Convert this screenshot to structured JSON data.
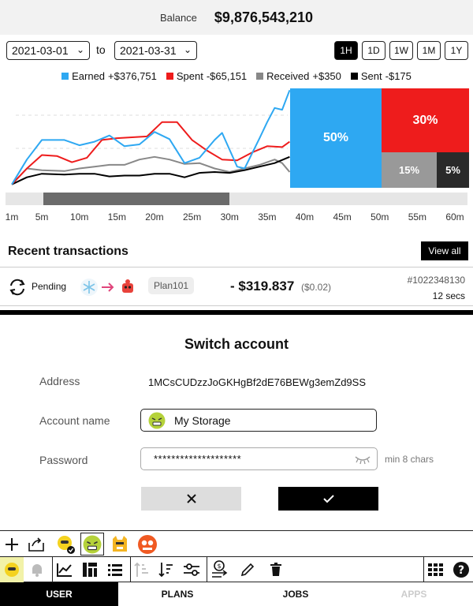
{
  "balance": {
    "label": "Balance",
    "value": "$9,876,543,210"
  },
  "date_range": {
    "from": "2021-03-01",
    "to_label": "to",
    "to": "2021-03-31"
  },
  "range_buttons": [
    {
      "label": "1H",
      "active": true
    },
    {
      "label": "1D",
      "active": false
    },
    {
      "label": "1W",
      "active": false
    },
    {
      "label": "1M",
      "active": false
    },
    {
      "label": "1Y",
      "active": false
    }
  ],
  "legend": [
    {
      "name": "Earned",
      "value": "+$376,751",
      "color": "#2ea8f2"
    },
    {
      "name": "Spent",
      "value": "-$65,151",
      "color": "#ee1c1c"
    },
    {
      "name": "Received",
      "value": "+$350",
      "color": "#888888"
    },
    {
      "name": "Sent",
      "value": "-$175",
      "color": "#000000"
    }
  ],
  "chart_data": {
    "type": "line",
    "x_ticks": [
      "1m",
      "5m",
      "10m",
      "15m",
      "20m",
      "25m",
      "30m",
      "35m",
      "40m",
      "45m",
      "50m",
      "55m",
      "60m"
    ],
    "series": [
      {
        "name": "Earned",
        "color": "#2ea8f2",
        "points": [
          [
            1,
            2
          ],
          [
            3,
            30
          ],
          [
            5,
            52
          ],
          [
            8,
            52
          ],
          [
            10,
            46
          ],
          [
            12,
            50
          ],
          [
            14,
            57
          ],
          [
            16,
            45
          ],
          [
            18,
            47
          ],
          [
            20,
            61
          ],
          [
            22,
            53
          ],
          [
            24,
            26
          ],
          [
            26,
            32
          ],
          [
            28,
            52
          ],
          [
            29,
            60
          ],
          [
            31,
            22
          ],
          [
            32,
            20
          ],
          [
            34,
            54
          ],
          [
            35,
            72
          ],
          [
            36,
            88
          ],
          [
            37,
            86
          ],
          [
            38,
            108
          ]
        ]
      },
      {
        "name": "Spent",
        "color": "#ee1c1c",
        "points": [
          [
            1,
            2
          ],
          [
            3,
            20
          ],
          [
            5,
            35
          ],
          [
            7,
            34
          ],
          [
            9,
            27
          ],
          [
            11,
            32
          ],
          [
            13,
            52
          ],
          [
            15,
            54
          ],
          [
            17,
            55
          ],
          [
            19,
            56
          ],
          [
            21,
            72
          ],
          [
            23,
            72
          ],
          [
            25,
            52
          ],
          [
            27,
            40
          ],
          [
            29,
            30
          ],
          [
            31,
            29
          ],
          [
            33,
            38
          ],
          [
            35,
            45
          ],
          [
            37,
            44
          ],
          [
            38,
            50
          ]
        ]
      },
      {
        "name": "Received",
        "color": "#888888",
        "points": [
          [
            1,
            2
          ],
          [
            3,
            20
          ],
          [
            5,
            18
          ],
          [
            8,
            17
          ],
          [
            10,
            20
          ],
          [
            12,
            22
          ],
          [
            14,
            24
          ],
          [
            16,
            24
          ],
          [
            18,
            30
          ],
          [
            20,
            33
          ],
          [
            22,
            30
          ],
          [
            24,
            25
          ],
          [
            26,
            26
          ],
          [
            28,
            20
          ],
          [
            30,
            16
          ],
          [
            32,
            20
          ],
          [
            34,
            24
          ],
          [
            36,
            30
          ],
          [
            37,
            26
          ],
          [
            38,
            16
          ]
        ]
      },
      {
        "name": "Sent",
        "color": "#000000",
        "points": [
          [
            1,
            2
          ],
          [
            3,
            10
          ],
          [
            5,
            14
          ],
          [
            8,
            13
          ],
          [
            10,
            14
          ],
          [
            12,
            14
          ],
          [
            14,
            11
          ],
          [
            16,
            12
          ],
          [
            18,
            12
          ],
          [
            20,
            14
          ],
          [
            22,
            14
          ],
          [
            24,
            10
          ],
          [
            26,
            15
          ],
          [
            28,
            16
          ],
          [
            30,
            15
          ],
          [
            32,
            18
          ],
          [
            34,
            22
          ],
          [
            36,
            26
          ],
          [
            38,
            33
          ]
        ]
      }
    ],
    "treemap": [
      {
        "label": "50%",
        "value": 50,
        "color": "#2ea8f2"
      },
      {
        "label": "30%",
        "value": 30,
        "color": "#ee1c1c"
      },
      {
        "label": "15%",
        "value": 15,
        "color": "#999999"
      },
      {
        "label": "5%",
        "value": 5,
        "color": "#2a2a2a"
      }
    ]
  },
  "recent": {
    "title": "Recent transactions",
    "view_all": "View all",
    "transaction": {
      "status": "Pending",
      "plan": "Plan101",
      "amount": "- $319.837",
      "fiat": "($0.02)",
      "id": "#1022348130",
      "time": "12 secs"
    }
  },
  "dialog": {
    "title": "Switch account",
    "address_label": "Address",
    "address": "1MCsCUDzzJoGKHgBf2dE76BEWg3emZd9SS",
    "account_name_label": "Account name",
    "account_name": "My Storage",
    "password_label": "Password",
    "password": "********************",
    "password_hint": "min 8 chars"
  },
  "nav": [
    {
      "label": "USER",
      "state": "active"
    },
    {
      "label": "PLANS",
      "state": "normal"
    },
    {
      "label": "JOBS",
      "state": "normal"
    },
    {
      "label": "APPS",
      "state": "disabled"
    }
  ]
}
